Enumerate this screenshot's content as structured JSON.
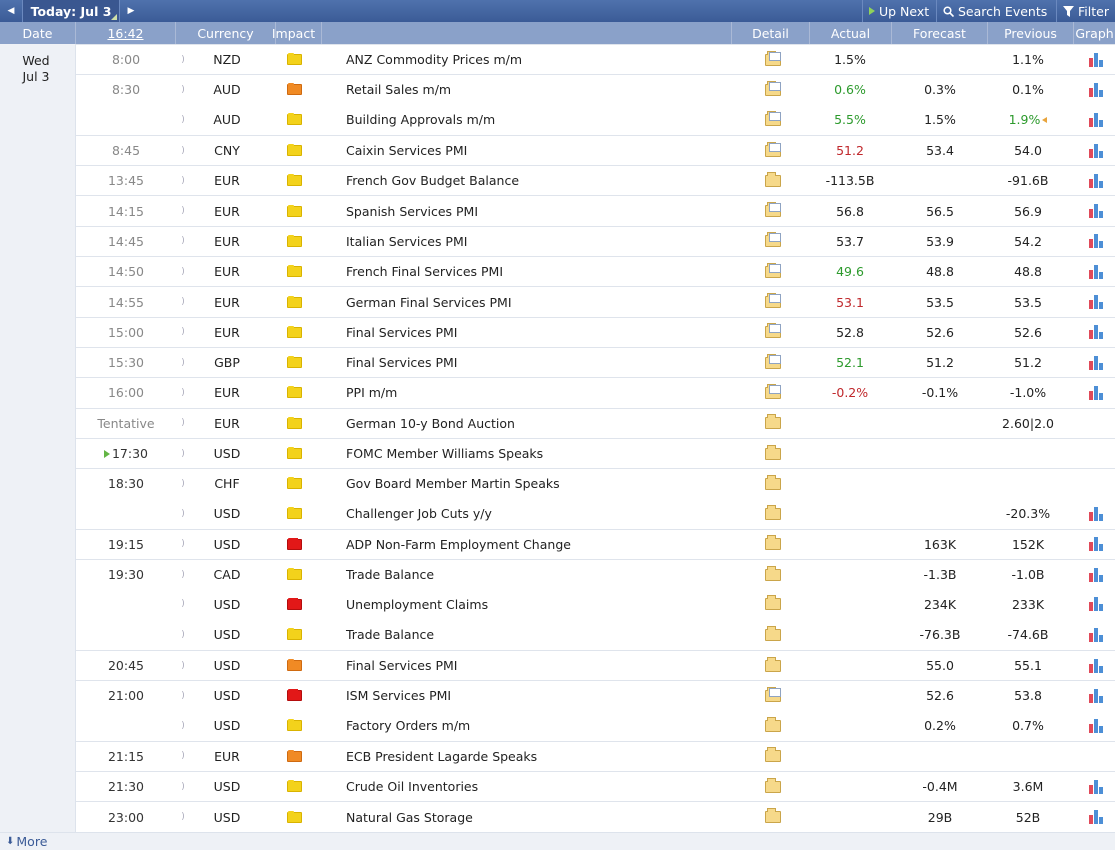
{
  "toolbar": {
    "today_label": "Today: Jul 3",
    "up_next_label": "Up Next",
    "search_label": "Search Events",
    "filter_label": "Filter"
  },
  "header": {
    "date": "Date",
    "time": "16:42",
    "currency": "Currency",
    "impact": "Impact",
    "detail": "Detail",
    "actual": "Actual",
    "forecast": "Forecast",
    "previous": "Previous",
    "graph": "Graph"
  },
  "day": {
    "weekday": "Wed",
    "date": "Jul 3"
  },
  "events": [
    {
      "time": "8:00",
      "currency": "NZD",
      "impact": "low",
      "event": "ANZ Commodity Prices m/m",
      "actual": "1.5%",
      "actual_class": "",
      "forecast": "",
      "previous": "1.1%",
      "graph": true,
      "detail_doc": true
    },
    {
      "time": "8:30",
      "currency": "AUD",
      "impact": "med",
      "event": "Retail Sales m/m",
      "actual": "0.6%",
      "actual_class": "pos",
      "forecast": "0.3%",
      "previous": "0.1%",
      "graph": true,
      "detail_doc": true
    },
    {
      "time": "",
      "currency": "AUD",
      "impact": "low",
      "event": "Building Approvals m/m",
      "actual": "5.5%",
      "actual_class": "pos",
      "forecast": "1.5%",
      "previous": "1.9%",
      "previous_class": "pos",
      "revised": true,
      "graph": true,
      "detail_doc": true
    },
    {
      "time": "8:45",
      "currency": "CNY",
      "impact": "low",
      "event": "Caixin Services PMI",
      "actual": "51.2",
      "actual_class": "neg",
      "forecast": "53.4",
      "previous": "54.0",
      "graph": true,
      "detail_doc": true
    },
    {
      "time": "13:45",
      "currency": "EUR",
      "impact": "low",
      "event": "French Gov Budget Balance",
      "actual": "-113.5B",
      "actual_class": "",
      "forecast": "",
      "previous": "-91.6B",
      "graph": true,
      "detail_doc": false
    },
    {
      "time": "14:15",
      "currency": "EUR",
      "impact": "low",
      "event": "Spanish Services PMI",
      "actual": "56.8",
      "actual_class": "",
      "forecast": "56.5",
      "previous": "56.9",
      "graph": true,
      "detail_doc": true
    },
    {
      "time": "14:45",
      "currency": "EUR",
      "impact": "low",
      "event": "Italian Services PMI",
      "actual": "53.7",
      "actual_class": "",
      "forecast": "53.9",
      "previous": "54.2",
      "graph": true,
      "detail_doc": true
    },
    {
      "time": "14:50",
      "currency": "EUR",
      "impact": "low",
      "event": "French Final Services PMI",
      "actual": "49.6",
      "actual_class": "pos",
      "forecast": "48.8",
      "previous": "48.8",
      "graph": true,
      "detail_doc": true
    },
    {
      "time": "14:55",
      "currency": "EUR",
      "impact": "low",
      "event": "German Final Services PMI",
      "actual": "53.1",
      "actual_class": "neg",
      "forecast": "53.5",
      "previous": "53.5",
      "graph": true,
      "detail_doc": true
    },
    {
      "time": "15:00",
      "currency": "EUR",
      "impact": "low",
      "event": "Final Services PMI",
      "actual": "52.8",
      "actual_class": "",
      "forecast": "52.6",
      "previous": "52.6",
      "graph": true,
      "detail_doc": true
    },
    {
      "time": "15:30",
      "currency": "GBP",
      "impact": "low",
      "event": "Final Services PMI",
      "actual": "52.1",
      "actual_class": "pos",
      "forecast": "51.2",
      "previous": "51.2",
      "graph": true,
      "detail_doc": true
    },
    {
      "time": "16:00",
      "currency": "EUR",
      "impact": "low",
      "event": "PPI m/m",
      "actual": "-0.2%",
      "actual_class": "neg",
      "forecast": "-0.1%",
      "previous": "-1.0%",
      "graph": true,
      "detail_doc": true
    },
    {
      "time": "Tentative",
      "currency": "EUR",
      "impact": "low",
      "event": "German 10-y Bond Auction",
      "actual": "",
      "actual_class": "",
      "forecast": "",
      "previous": "2.60|2.0",
      "graph": false,
      "detail_doc": false
    },
    {
      "time": "17:30",
      "currency": "USD",
      "impact": "low",
      "event": "FOMC Member Williams Speaks",
      "actual": "",
      "actual_class": "",
      "forecast": "",
      "previous": "",
      "graph": false,
      "detail_doc": false,
      "upnext": true
    },
    {
      "time": "18:30",
      "currency": "CHF",
      "impact": "low",
      "event": "Gov Board Member Martin Speaks",
      "actual": "",
      "actual_class": "",
      "forecast": "",
      "previous": "",
      "graph": false,
      "detail_doc": false
    },
    {
      "time": "",
      "currency": "USD",
      "impact": "low",
      "event": "Challenger Job Cuts y/y",
      "actual": "",
      "actual_class": "",
      "forecast": "",
      "previous": "-20.3%",
      "graph": true,
      "detail_doc": false
    },
    {
      "time": "19:15",
      "currency": "USD",
      "impact": "high",
      "event": "ADP Non-Farm Employment Change",
      "actual": "",
      "actual_class": "",
      "forecast": "163K",
      "previous": "152K",
      "graph": true,
      "detail_doc": false
    },
    {
      "time": "19:30",
      "currency": "CAD",
      "impact": "low",
      "event": "Trade Balance",
      "actual": "",
      "actual_class": "",
      "forecast": "-1.3B",
      "previous": "-1.0B",
      "graph": true,
      "detail_doc": false
    },
    {
      "time": "",
      "currency": "USD",
      "impact": "high",
      "event": "Unemployment Claims",
      "actual": "",
      "actual_class": "",
      "forecast": "234K",
      "previous": "233K",
      "graph": true,
      "detail_doc": false
    },
    {
      "time": "",
      "currency": "USD",
      "impact": "low",
      "event": "Trade Balance",
      "actual": "",
      "actual_class": "",
      "forecast": "-76.3B",
      "previous": "-74.6B",
      "graph": true,
      "detail_doc": false
    },
    {
      "time": "20:45",
      "currency": "USD",
      "impact": "med",
      "event": "Final Services PMI",
      "actual": "",
      "actual_class": "",
      "forecast": "55.0",
      "previous": "55.1",
      "graph": true,
      "detail_doc": false
    },
    {
      "time": "21:00",
      "currency": "USD",
      "impact": "high",
      "event": "ISM Services PMI",
      "actual": "",
      "actual_class": "",
      "forecast": "52.6",
      "previous": "53.8",
      "graph": true,
      "detail_doc": true
    },
    {
      "time": "",
      "currency": "USD",
      "impact": "low",
      "event": "Factory Orders m/m",
      "actual": "",
      "actual_class": "",
      "forecast": "0.2%",
      "previous": "0.7%",
      "graph": true,
      "detail_doc": false
    },
    {
      "time": "21:15",
      "currency": "EUR",
      "impact": "med",
      "event": "ECB President Lagarde Speaks",
      "actual": "",
      "actual_class": "",
      "forecast": "",
      "previous": "",
      "graph": false,
      "detail_doc": false
    },
    {
      "time": "21:30",
      "currency": "USD",
      "impact": "low",
      "event": "Crude Oil Inventories",
      "actual": "",
      "actual_class": "",
      "forecast": "-0.4M",
      "previous": "3.6M",
      "graph": true,
      "detail_doc": false
    },
    {
      "time": "23:00",
      "currency": "USD",
      "impact": "low",
      "event": "Natural Gas Storage",
      "actual": "",
      "actual_class": "",
      "forecast": "29B",
      "previous": "52B",
      "graph": true,
      "detail_doc": false
    }
  ],
  "footer": {
    "more_label": "More"
  }
}
